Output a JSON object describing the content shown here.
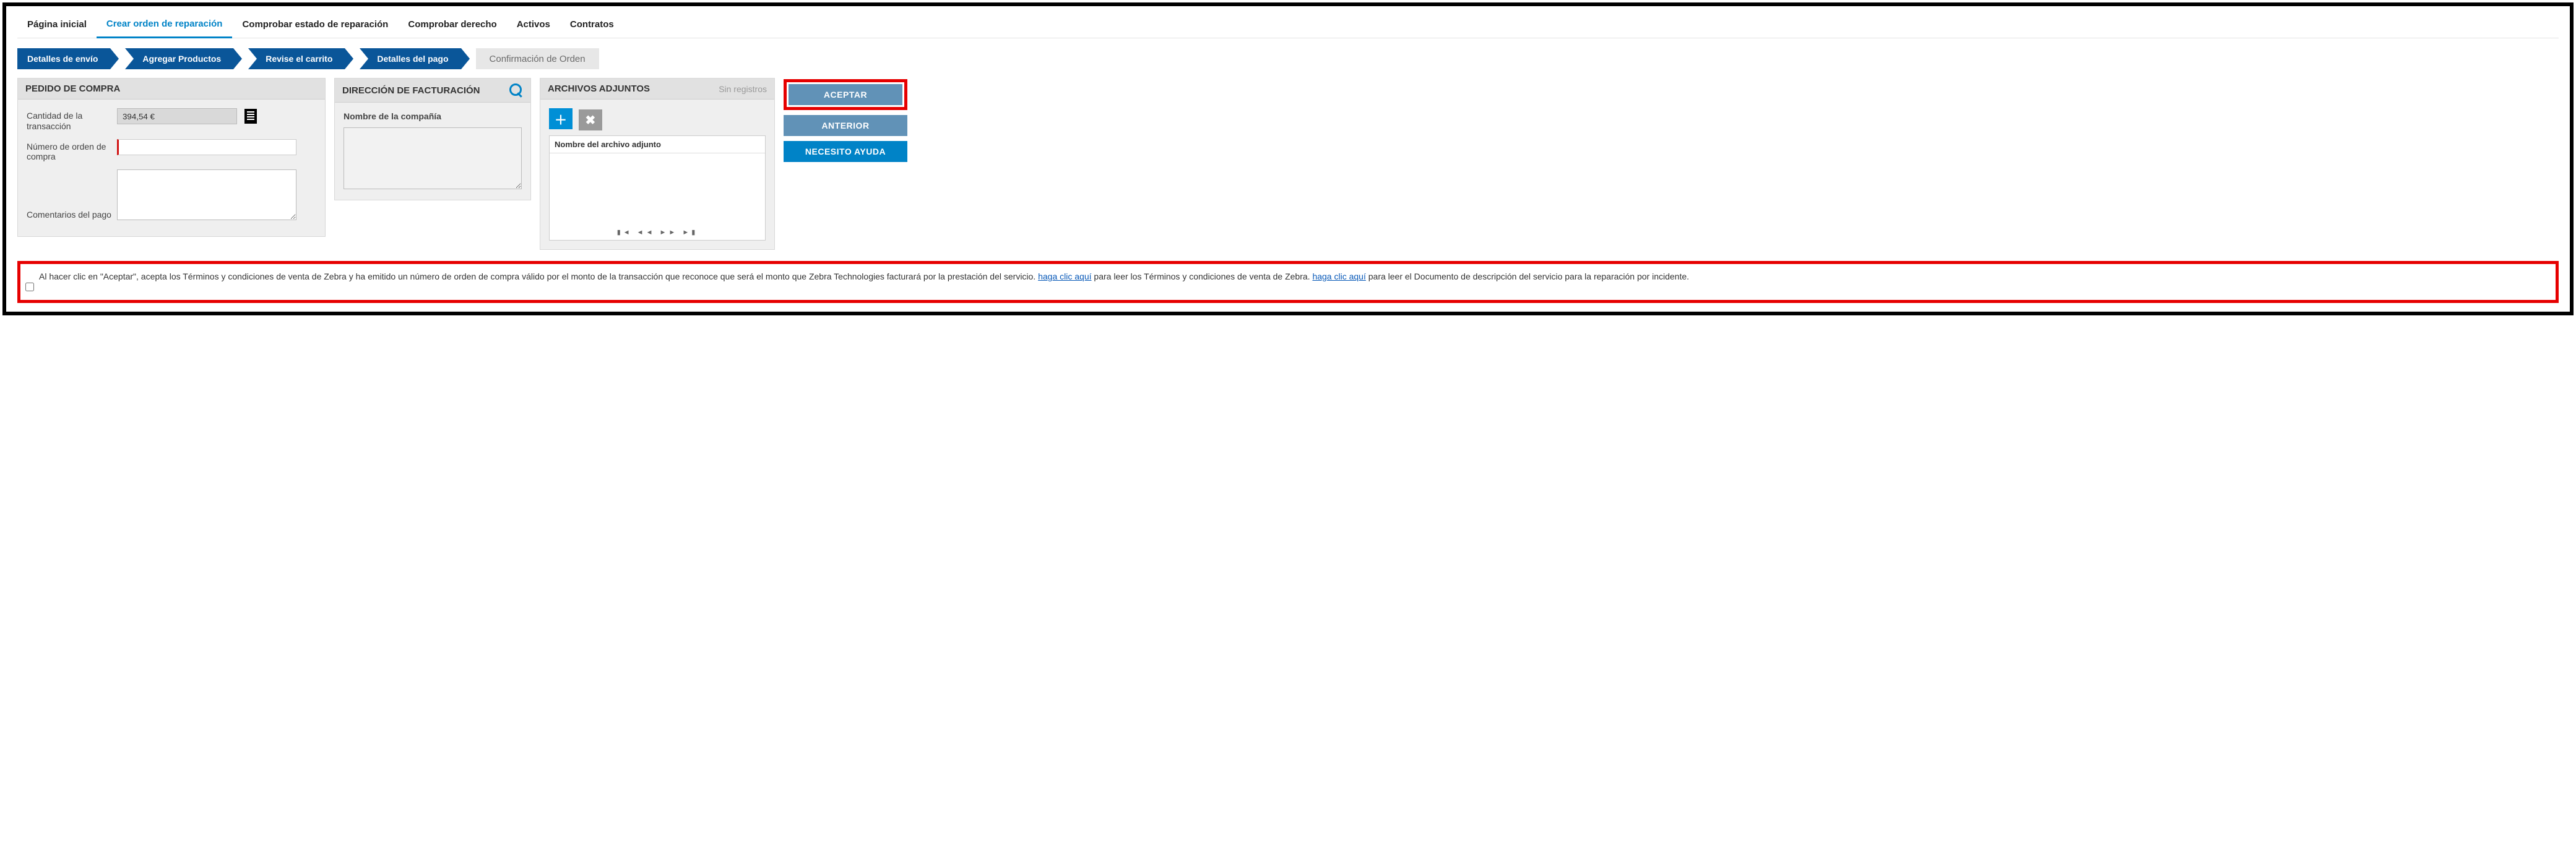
{
  "nav": {
    "home": "Página inicial",
    "create": "Crear orden de reparación",
    "status": "Comprobar estado de reparación",
    "right": "Comprobar derecho",
    "assets": "Activos",
    "contracts": "Contratos"
  },
  "progress": {
    "s1": "Detalles de envío",
    "s2": "Agregar Productos",
    "s3": "Revise el carrito",
    "s4": "Detalles del pago",
    "s5": "Confirmación de Orden"
  },
  "purchase": {
    "title": "PEDIDO DE COMPRA",
    "amount_label": "Cantidad de la transacción",
    "amount_value": "394,54 €",
    "po_label": "Número de orden de compra",
    "po_value": "",
    "comments_label": "Comentarios del pago",
    "comments_value": ""
  },
  "billing": {
    "title": "DIRECCIÓN DE FACTURACIÓN",
    "company_label": "Nombre de la compañía",
    "address_value": ""
  },
  "attach": {
    "title": "ARCHIVOS ADJUNTOS",
    "none": "Sin registros",
    "col": "Nombre del archivo adjunto",
    "pager": "▮◄  ◄◄  ►►  ►▮"
  },
  "actions": {
    "accept": "ACEPTAR",
    "prev": "ANTERIOR",
    "help": "NECESITO AYUDA"
  },
  "terms": {
    "t1": "Al hacer clic en \"Aceptar\", acepta los Términos y condiciones de venta de Zebra y ha emitido un número de orden de compra válido por el monto de la transacción que reconoce que será el monto que Zebra Technologies facturará por la prestación del servicio. ",
    "link1": " haga clic aquí",
    "t2": " para leer los Términos y condiciones de venta de Zebra. ",
    "link2": " haga clic aquí",
    "t3": " para leer el Documento de descripción del servicio para la reparación por incidente."
  }
}
